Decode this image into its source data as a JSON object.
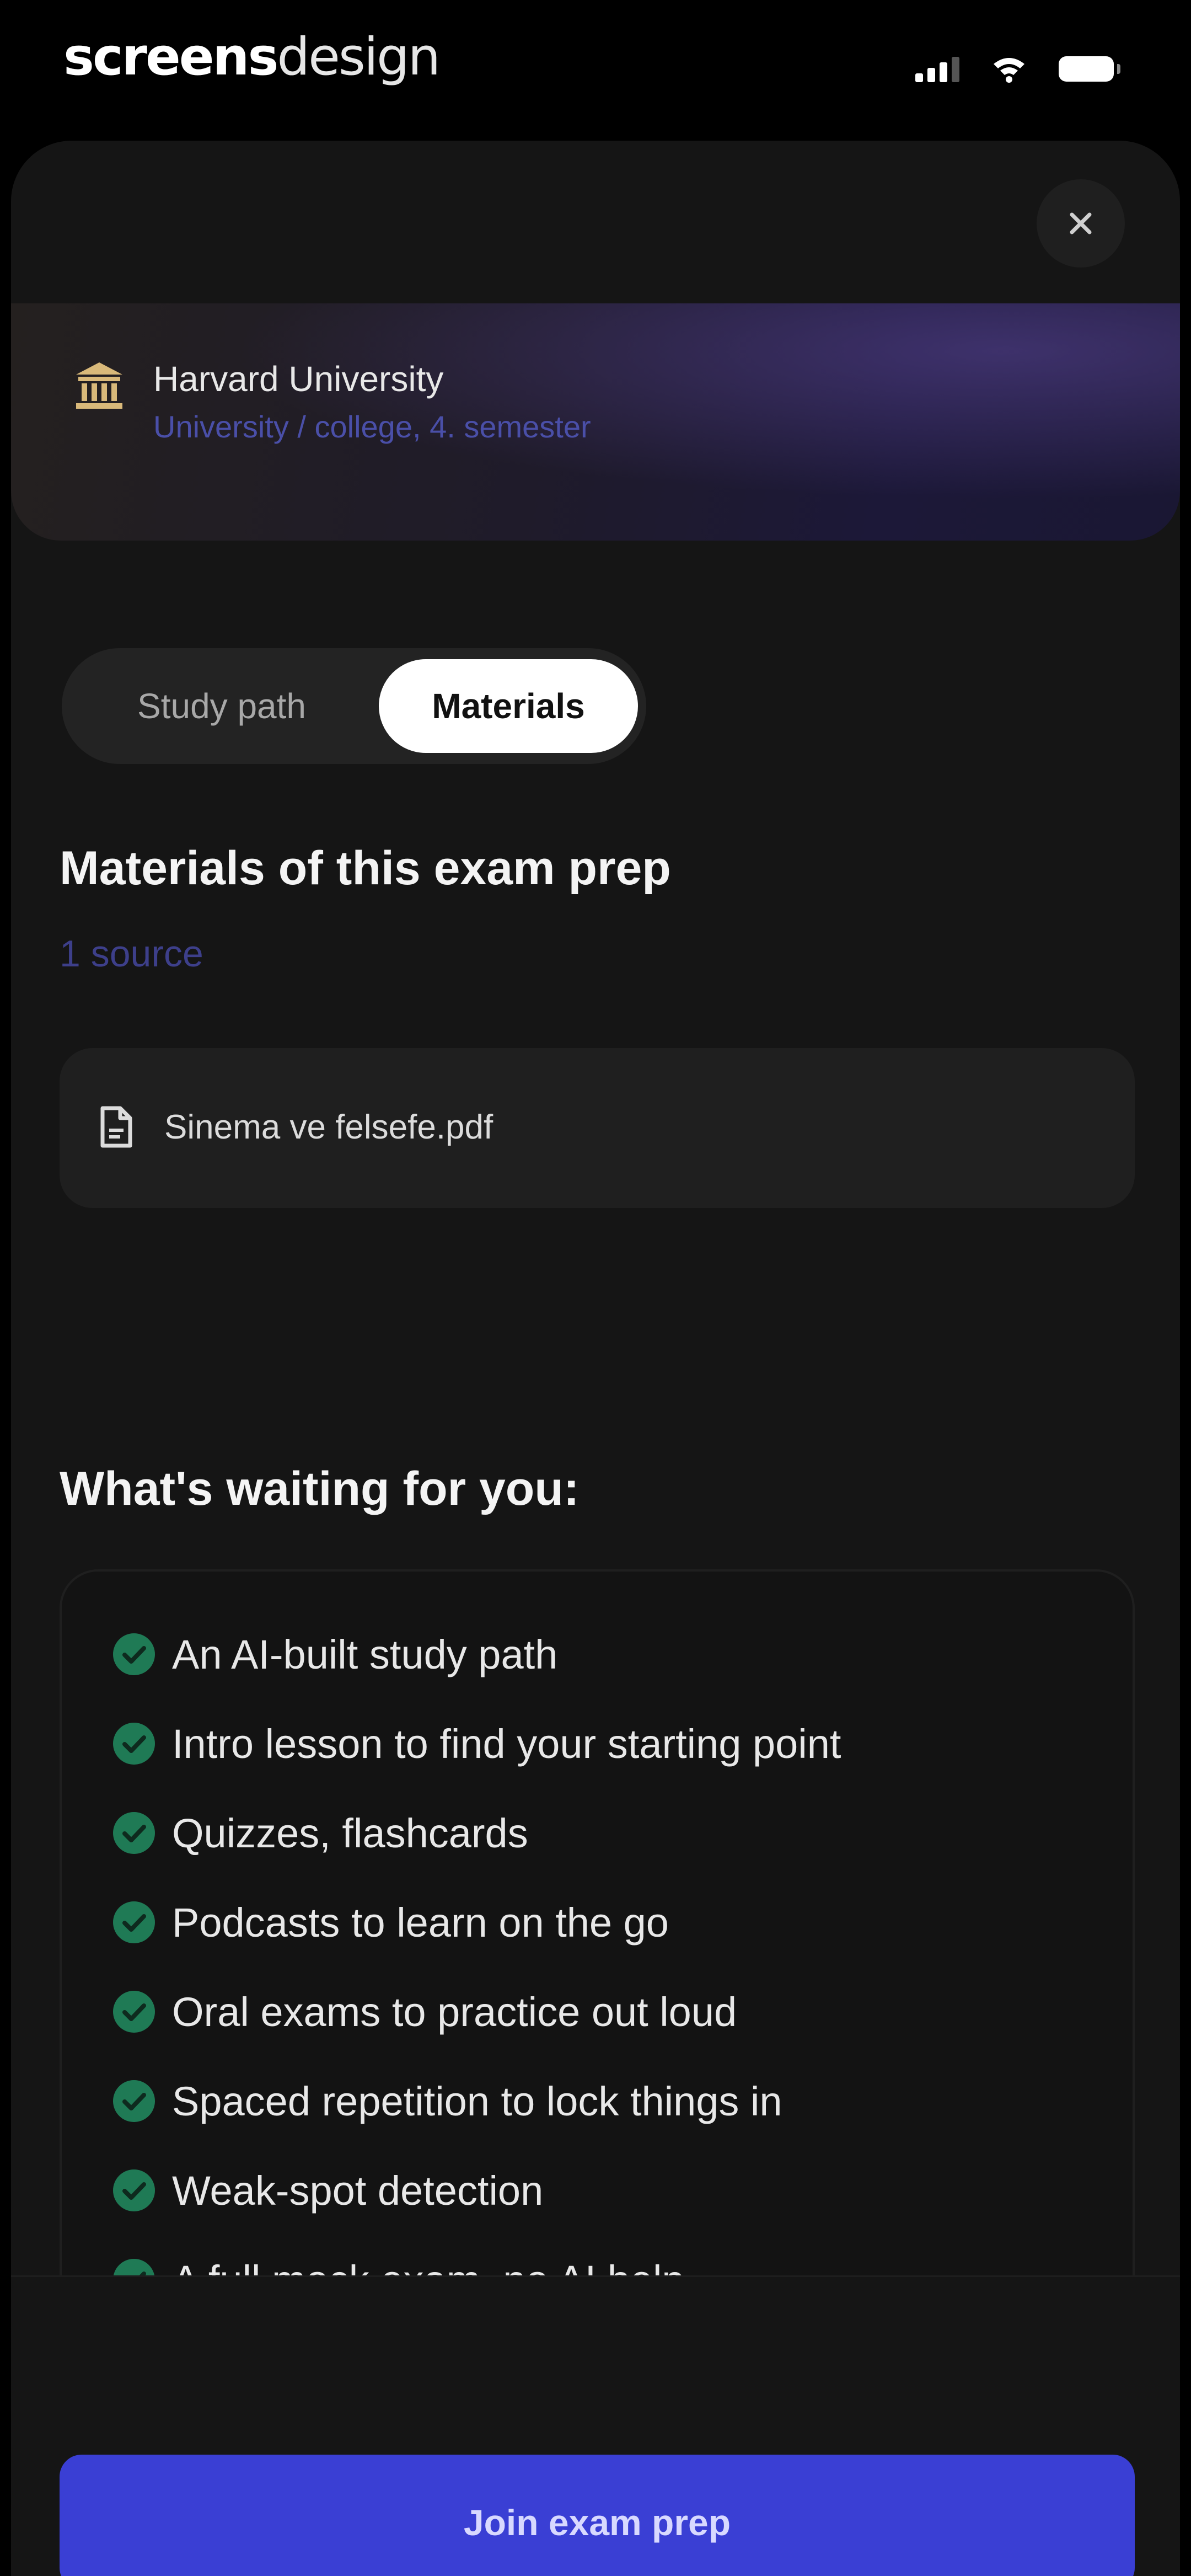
{
  "status_bar": {
    "logo_bold": "screens",
    "logo_light": "design",
    "icons": [
      "signal-icon",
      "wifi-icon",
      "battery-icon"
    ]
  },
  "sheet": {
    "close_icon": "close-icon",
    "hero": {
      "university_icon": "university-icon",
      "university_name": "Harvard University",
      "university_detail": "University / college, 4. semester"
    },
    "tabs": [
      {
        "label": "Study path",
        "selected": false
      },
      {
        "label": "Materials",
        "selected": true
      }
    ],
    "materials": {
      "title": "Materials of this exam prep",
      "source_count": "1 source",
      "files": [
        {
          "icon": "document-icon",
          "name": "Sinema ve felsefe.pdf"
        }
      ]
    },
    "features": {
      "title": "What's waiting for you:",
      "check_icon": "check-circle-icon",
      "items": [
        "An AI-built study path",
        "Intro lesson to find your starting point",
        "Quizzes, flashcards",
        "Podcasts to learn on the go",
        "Oral exams to practice out loud",
        "Spaced repetition to lock things in",
        "Weak-spot detection",
        "A full mock exam, no AI help"
      ]
    },
    "cta": {
      "label": "Join exam prep"
    }
  },
  "colors": {
    "background": "#000000",
    "sheet": "#151515",
    "accent_button": "#3a3fd4",
    "check_green": "#1f7a55",
    "subtle_link": "#4a4fa8"
  }
}
